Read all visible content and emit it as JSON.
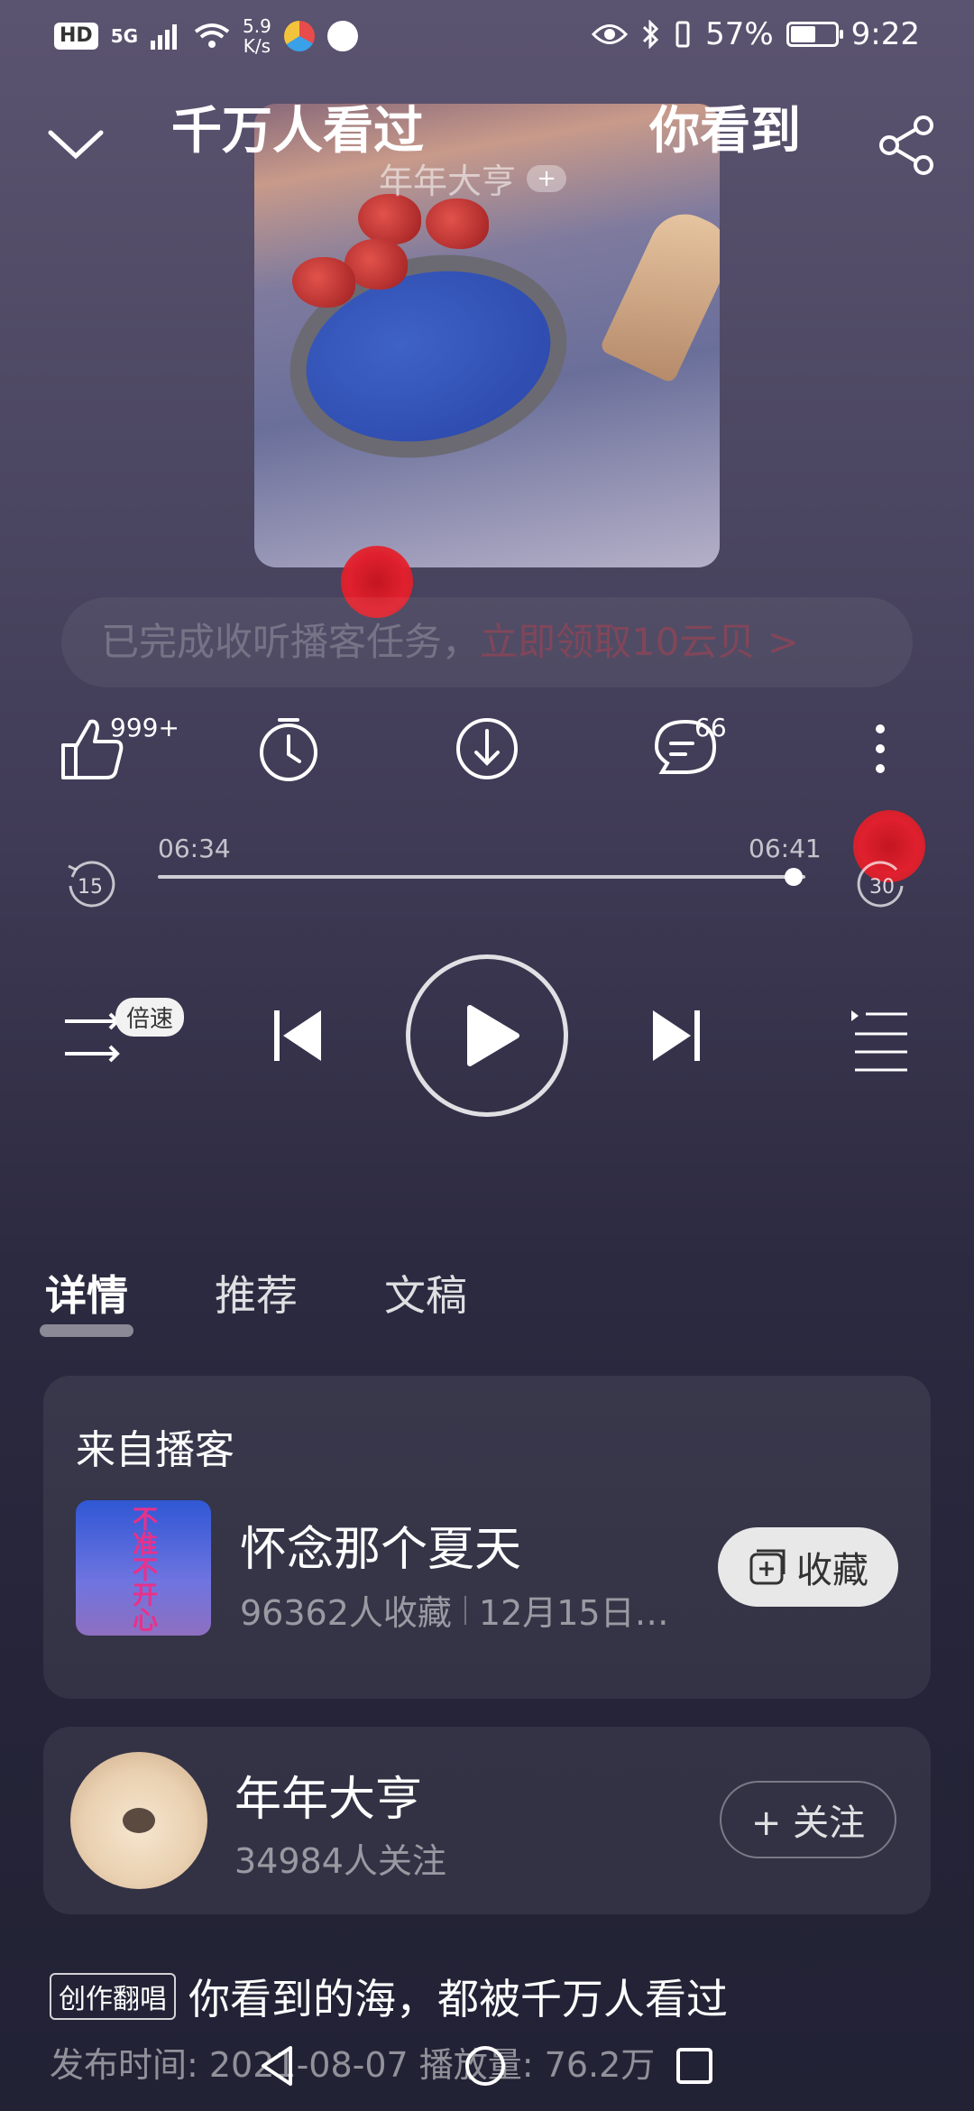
{
  "status_bar": {
    "hd": "HD",
    "network": "5G",
    "speed_value": "5.9",
    "speed_unit": "K/s",
    "battery_percent": "57%",
    "battery_level": 0.57,
    "time": "9:22"
  },
  "header": {
    "title_left": "千万人看过",
    "title_right": "你看到",
    "author": "年年大亨",
    "author_follow_glyph": "+"
  },
  "banner": {
    "text_prefix": "已完成收听播客任务，",
    "text_link": "立即领取10云贝 >"
  },
  "actions": {
    "like_count": "999+",
    "comment_count": "66"
  },
  "progress": {
    "current": "06:34",
    "total": "06:41",
    "fraction": 0.982,
    "rewind_seconds": "15",
    "forward_seconds": "30"
  },
  "controls": {
    "speed_label": "倍速"
  },
  "tabs": [
    {
      "label": "详情",
      "active": true
    },
    {
      "label": "推荐",
      "active": false
    },
    {
      "label": "文稿",
      "active": false
    }
  ],
  "podcast_card": {
    "heading": "来自播客",
    "thumb_text": "不准不开心",
    "name": "怀念那个夏天",
    "subscribers": "96362人收藏",
    "updated": "12月15日…",
    "collect_label": "收藏"
  },
  "author_card": {
    "name": "年年大亨",
    "followers": "34984人关注",
    "follow_label": "+ 关注"
  },
  "episode": {
    "tag": "创作翻唱",
    "title": "你看到的海，都被千万人看过",
    "meta": "发布时间: 2021-08-07  播放量: 76.2万"
  },
  "colors": {
    "accent_red": "#e0202e",
    "background_top": "#5b5470",
    "background_bottom": "#222235"
  }
}
